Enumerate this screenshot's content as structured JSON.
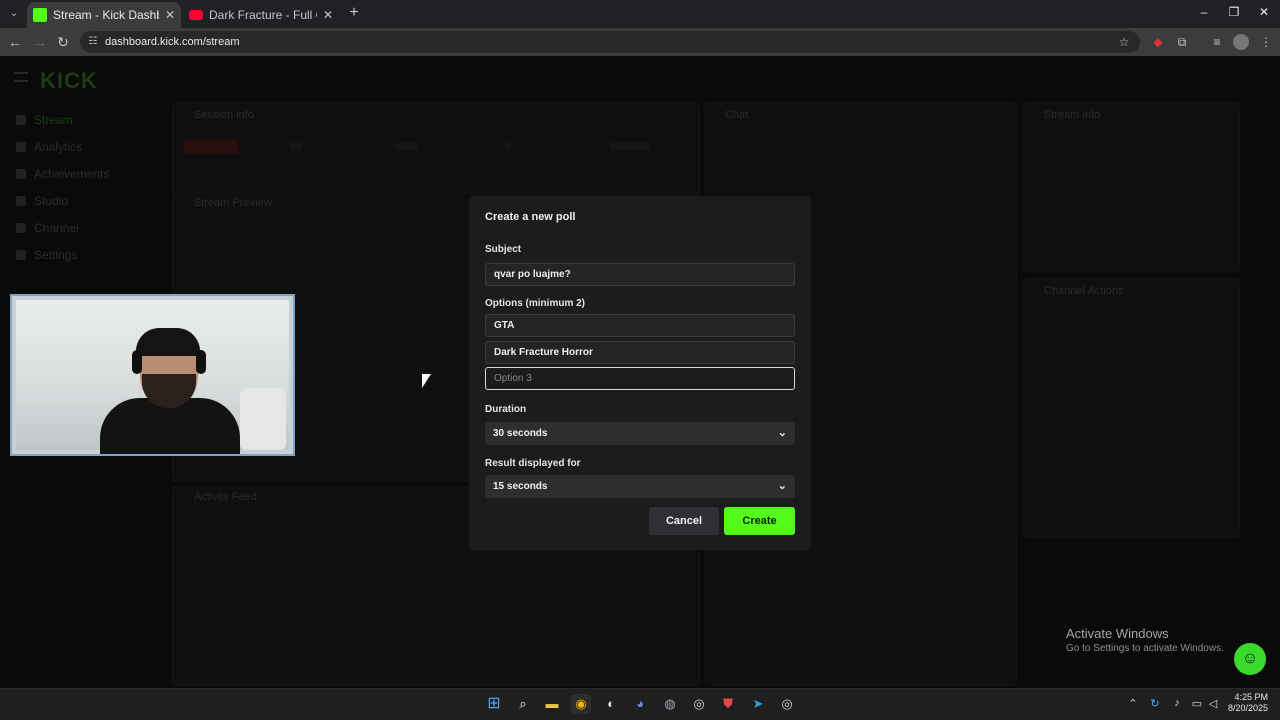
{
  "browser": {
    "tabs": [
      {
        "title": "Stream - Kick Dashboard",
        "active": true,
        "favicon_color": "#53fc18"
      },
      {
        "title": "Dark Fracture - Full Gameplay W",
        "active": false,
        "favicon_color": "#ff0033"
      }
    ],
    "url": "dashboard.kick.com/stream"
  },
  "background_page": {
    "logo": "KICK",
    "nav": [
      "Stream",
      "Analytics",
      "Achievements",
      "Studio",
      "Channel",
      "Settings"
    ],
    "panels": [
      "Session info",
      "Chat",
      "Stream info",
      "Stream Preview",
      "Activity Feed",
      "Channel Actions"
    ]
  },
  "modal": {
    "title": "Create a new poll",
    "subject_label": "Subject",
    "subject_value": "qvar po luajme?",
    "options_label": "Options (minimum 2)",
    "options": [
      "GTA",
      "Dark Fracture Horror"
    ],
    "option3_placeholder": "Option 3",
    "duration_label": "Duration",
    "duration_value": "30 seconds",
    "result_label": "Result displayed for",
    "result_value": "15 seconds",
    "cancel_label": "Cancel",
    "create_label": "Create",
    "accent": "#53fc18"
  },
  "watermark": {
    "line1": "Activate Windows",
    "line2": "Go to Settings to activate Windows."
  },
  "taskbar": {
    "time": "4:25 PM",
    "date": "8/20/2025"
  }
}
